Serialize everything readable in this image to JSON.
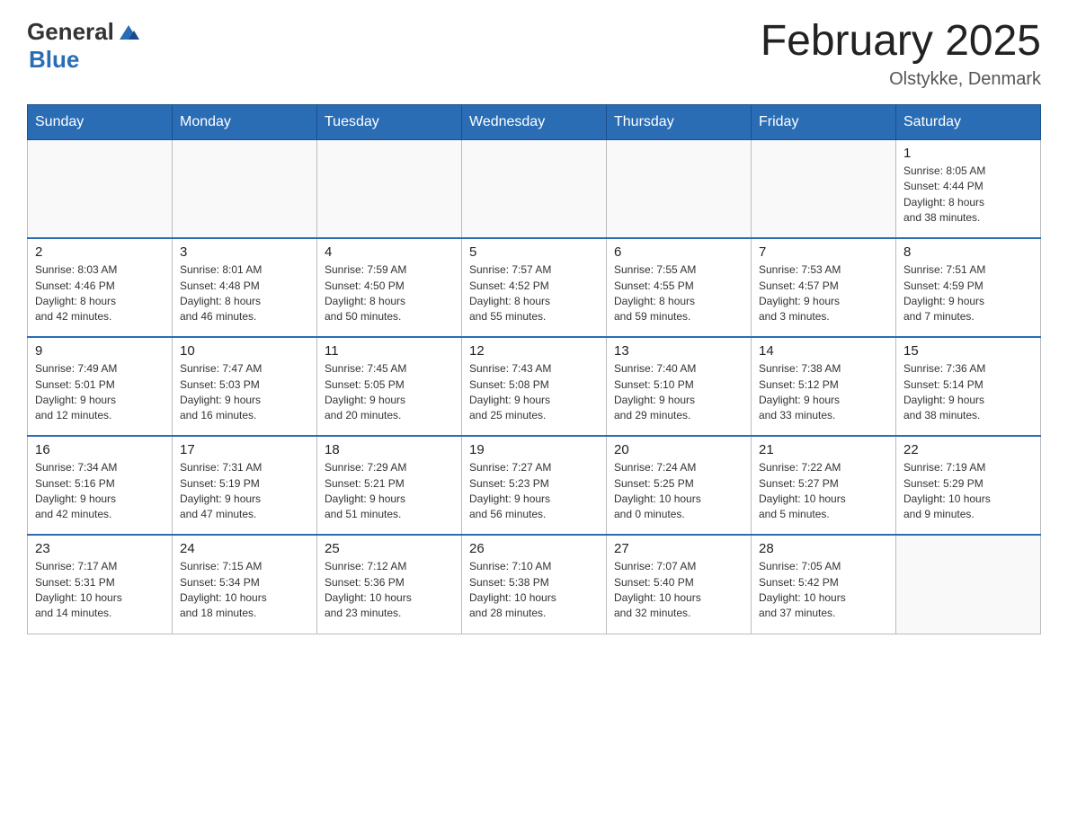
{
  "header": {
    "logo_general": "General",
    "logo_blue": "Blue",
    "month_title": "February 2025",
    "location": "Olstykke, Denmark"
  },
  "days_of_week": [
    "Sunday",
    "Monday",
    "Tuesday",
    "Wednesday",
    "Thursday",
    "Friday",
    "Saturday"
  ],
  "weeks": [
    [
      {
        "day": "",
        "info": ""
      },
      {
        "day": "",
        "info": ""
      },
      {
        "day": "",
        "info": ""
      },
      {
        "day": "",
        "info": ""
      },
      {
        "day": "",
        "info": ""
      },
      {
        "day": "",
        "info": ""
      },
      {
        "day": "1",
        "info": "Sunrise: 8:05 AM\nSunset: 4:44 PM\nDaylight: 8 hours\nand 38 minutes."
      }
    ],
    [
      {
        "day": "2",
        "info": "Sunrise: 8:03 AM\nSunset: 4:46 PM\nDaylight: 8 hours\nand 42 minutes."
      },
      {
        "day": "3",
        "info": "Sunrise: 8:01 AM\nSunset: 4:48 PM\nDaylight: 8 hours\nand 46 minutes."
      },
      {
        "day": "4",
        "info": "Sunrise: 7:59 AM\nSunset: 4:50 PM\nDaylight: 8 hours\nand 50 minutes."
      },
      {
        "day": "5",
        "info": "Sunrise: 7:57 AM\nSunset: 4:52 PM\nDaylight: 8 hours\nand 55 minutes."
      },
      {
        "day": "6",
        "info": "Sunrise: 7:55 AM\nSunset: 4:55 PM\nDaylight: 8 hours\nand 59 minutes."
      },
      {
        "day": "7",
        "info": "Sunrise: 7:53 AM\nSunset: 4:57 PM\nDaylight: 9 hours\nand 3 minutes."
      },
      {
        "day": "8",
        "info": "Sunrise: 7:51 AM\nSunset: 4:59 PM\nDaylight: 9 hours\nand 7 minutes."
      }
    ],
    [
      {
        "day": "9",
        "info": "Sunrise: 7:49 AM\nSunset: 5:01 PM\nDaylight: 9 hours\nand 12 minutes."
      },
      {
        "day": "10",
        "info": "Sunrise: 7:47 AM\nSunset: 5:03 PM\nDaylight: 9 hours\nand 16 minutes."
      },
      {
        "day": "11",
        "info": "Sunrise: 7:45 AM\nSunset: 5:05 PM\nDaylight: 9 hours\nand 20 minutes."
      },
      {
        "day": "12",
        "info": "Sunrise: 7:43 AM\nSunset: 5:08 PM\nDaylight: 9 hours\nand 25 minutes."
      },
      {
        "day": "13",
        "info": "Sunrise: 7:40 AM\nSunset: 5:10 PM\nDaylight: 9 hours\nand 29 minutes."
      },
      {
        "day": "14",
        "info": "Sunrise: 7:38 AM\nSunset: 5:12 PM\nDaylight: 9 hours\nand 33 minutes."
      },
      {
        "day": "15",
        "info": "Sunrise: 7:36 AM\nSunset: 5:14 PM\nDaylight: 9 hours\nand 38 minutes."
      }
    ],
    [
      {
        "day": "16",
        "info": "Sunrise: 7:34 AM\nSunset: 5:16 PM\nDaylight: 9 hours\nand 42 minutes."
      },
      {
        "day": "17",
        "info": "Sunrise: 7:31 AM\nSunset: 5:19 PM\nDaylight: 9 hours\nand 47 minutes."
      },
      {
        "day": "18",
        "info": "Sunrise: 7:29 AM\nSunset: 5:21 PM\nDaylight: 9 hours\nand 51 minutes."
      },
      {
        "day": "19",
        "info": "Sunrise: 7:27 AM\nSunset: 5:23 PM\nDaylight: 9 hours\nand 56 minutes."
      },
      {
        "day": "20",
        "info": "Sunrise: 7:24 AM\nSunset: 5:25 PM\nDaylight: 10 hours\nand 0 minutes."
      },
      {
        "day": "21",
        "info": "Sunrise: 7:22 AM\nSunset: 5:27 PM\nDaylight: 10 hours\nand 5 minutes."
      },
      {
        "day": "22",
        "info": "Sunrise: 7:19 AM\nSunset: 5:29 PM\nDaylight: 10 hours\nand 9 minutes."
      }
    ],
    [
      {
        "day": "23",
        "info": "Sunrise: 7:17 AM\nSunset: 5:31 PM\nDaylight: 10 hours\nand 14 minutes."
      },
      {
        "day": "24",
        "info": "Sunrise: 7:15 AM\nSunset: 5:34 PM\nDaylight: 10 hours\nand 18 minutes."
      },
      {
        "day": "25",
        "info": "Sunrise: 7:12 AM\nSunset: 5:36 PM\nDaylight: 10 hours\nand 23 minutes."
      },
      {
        "day": "26",
        "info": "Sunrise: 7:10 AM\nSunset: 5:38 PM\nDaylight: 10 hours\nand 28 minutes."
      },
      {
        "day": "27",
        "info": "Sunrise: 7:07 AM\nSunset: 5:40 PM\nDaylight: 10 hours\nand 32 minutes."
      },
      {
        "day": "28",
        "info": "Sunrise: 7:05 AM\nSunset: 5:42 PM\nDaylight: 10 hours\nand 37 minutes."
      },
      {
        "day": "",
        "info": ""
      }
    ]
  ]
}
